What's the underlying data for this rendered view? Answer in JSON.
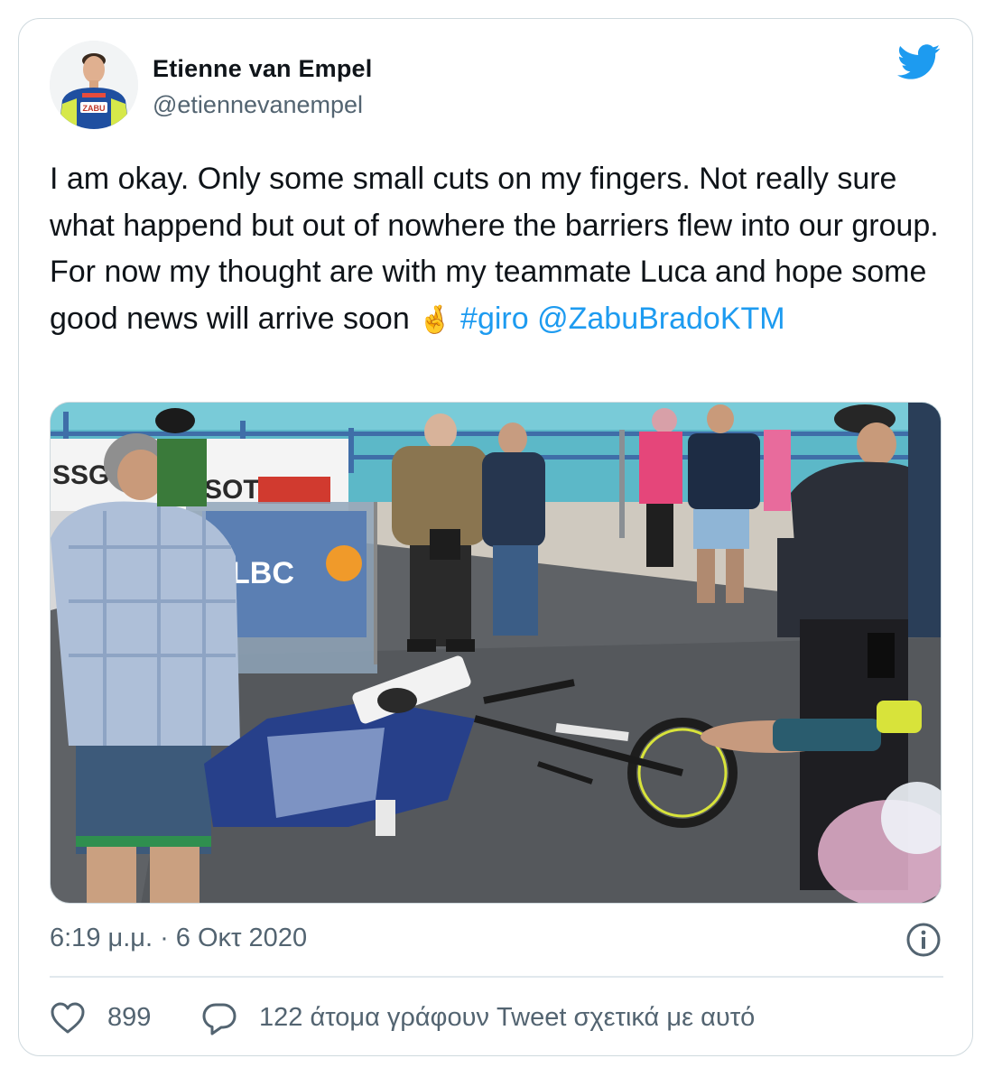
{
  "author": {
    "name": "Etienne van Empel",
    "handle": "@etiennevanempel",
    "avatar_jersey_text": "ZABU"
  },
  "tweet": {
    "text_plain": "I am okay. Only some small cuts on my fingers. Not really sure what happend but out of nowhere the barriers flew into our group. For now my thought are with my teammate Luca and hope some good news will arrive soon",
    "emoji": "🤞",
    "hashtag": "#giro",
    "mention": "@ZabuBradoKTM"
  },
  "media": {
    "banner_text": "SSG",
    "banner_text_2": "SOT",
    "barrier_text": "LBC"
  },
  "footer": {
    "timestamp": "6:19 μ.μ. · 6 Οκτ 2020",
    "like_count": "899",
    "reply_text": "122 άτομα γράφουν Tweet σχετικά με αυτό"
  },
  "icons": {
    "brand": "twitter-bird-icon",
    "info": "info-icon",
    "like": "heart-icon",
    "reply": "speech-bubble-icon"
  },
  "colors": {
    "link": "#1d9bf0",
    "text": "#0f1419",
    "muted": "#536471",
    "border": "#cfd9de"
  }
}
